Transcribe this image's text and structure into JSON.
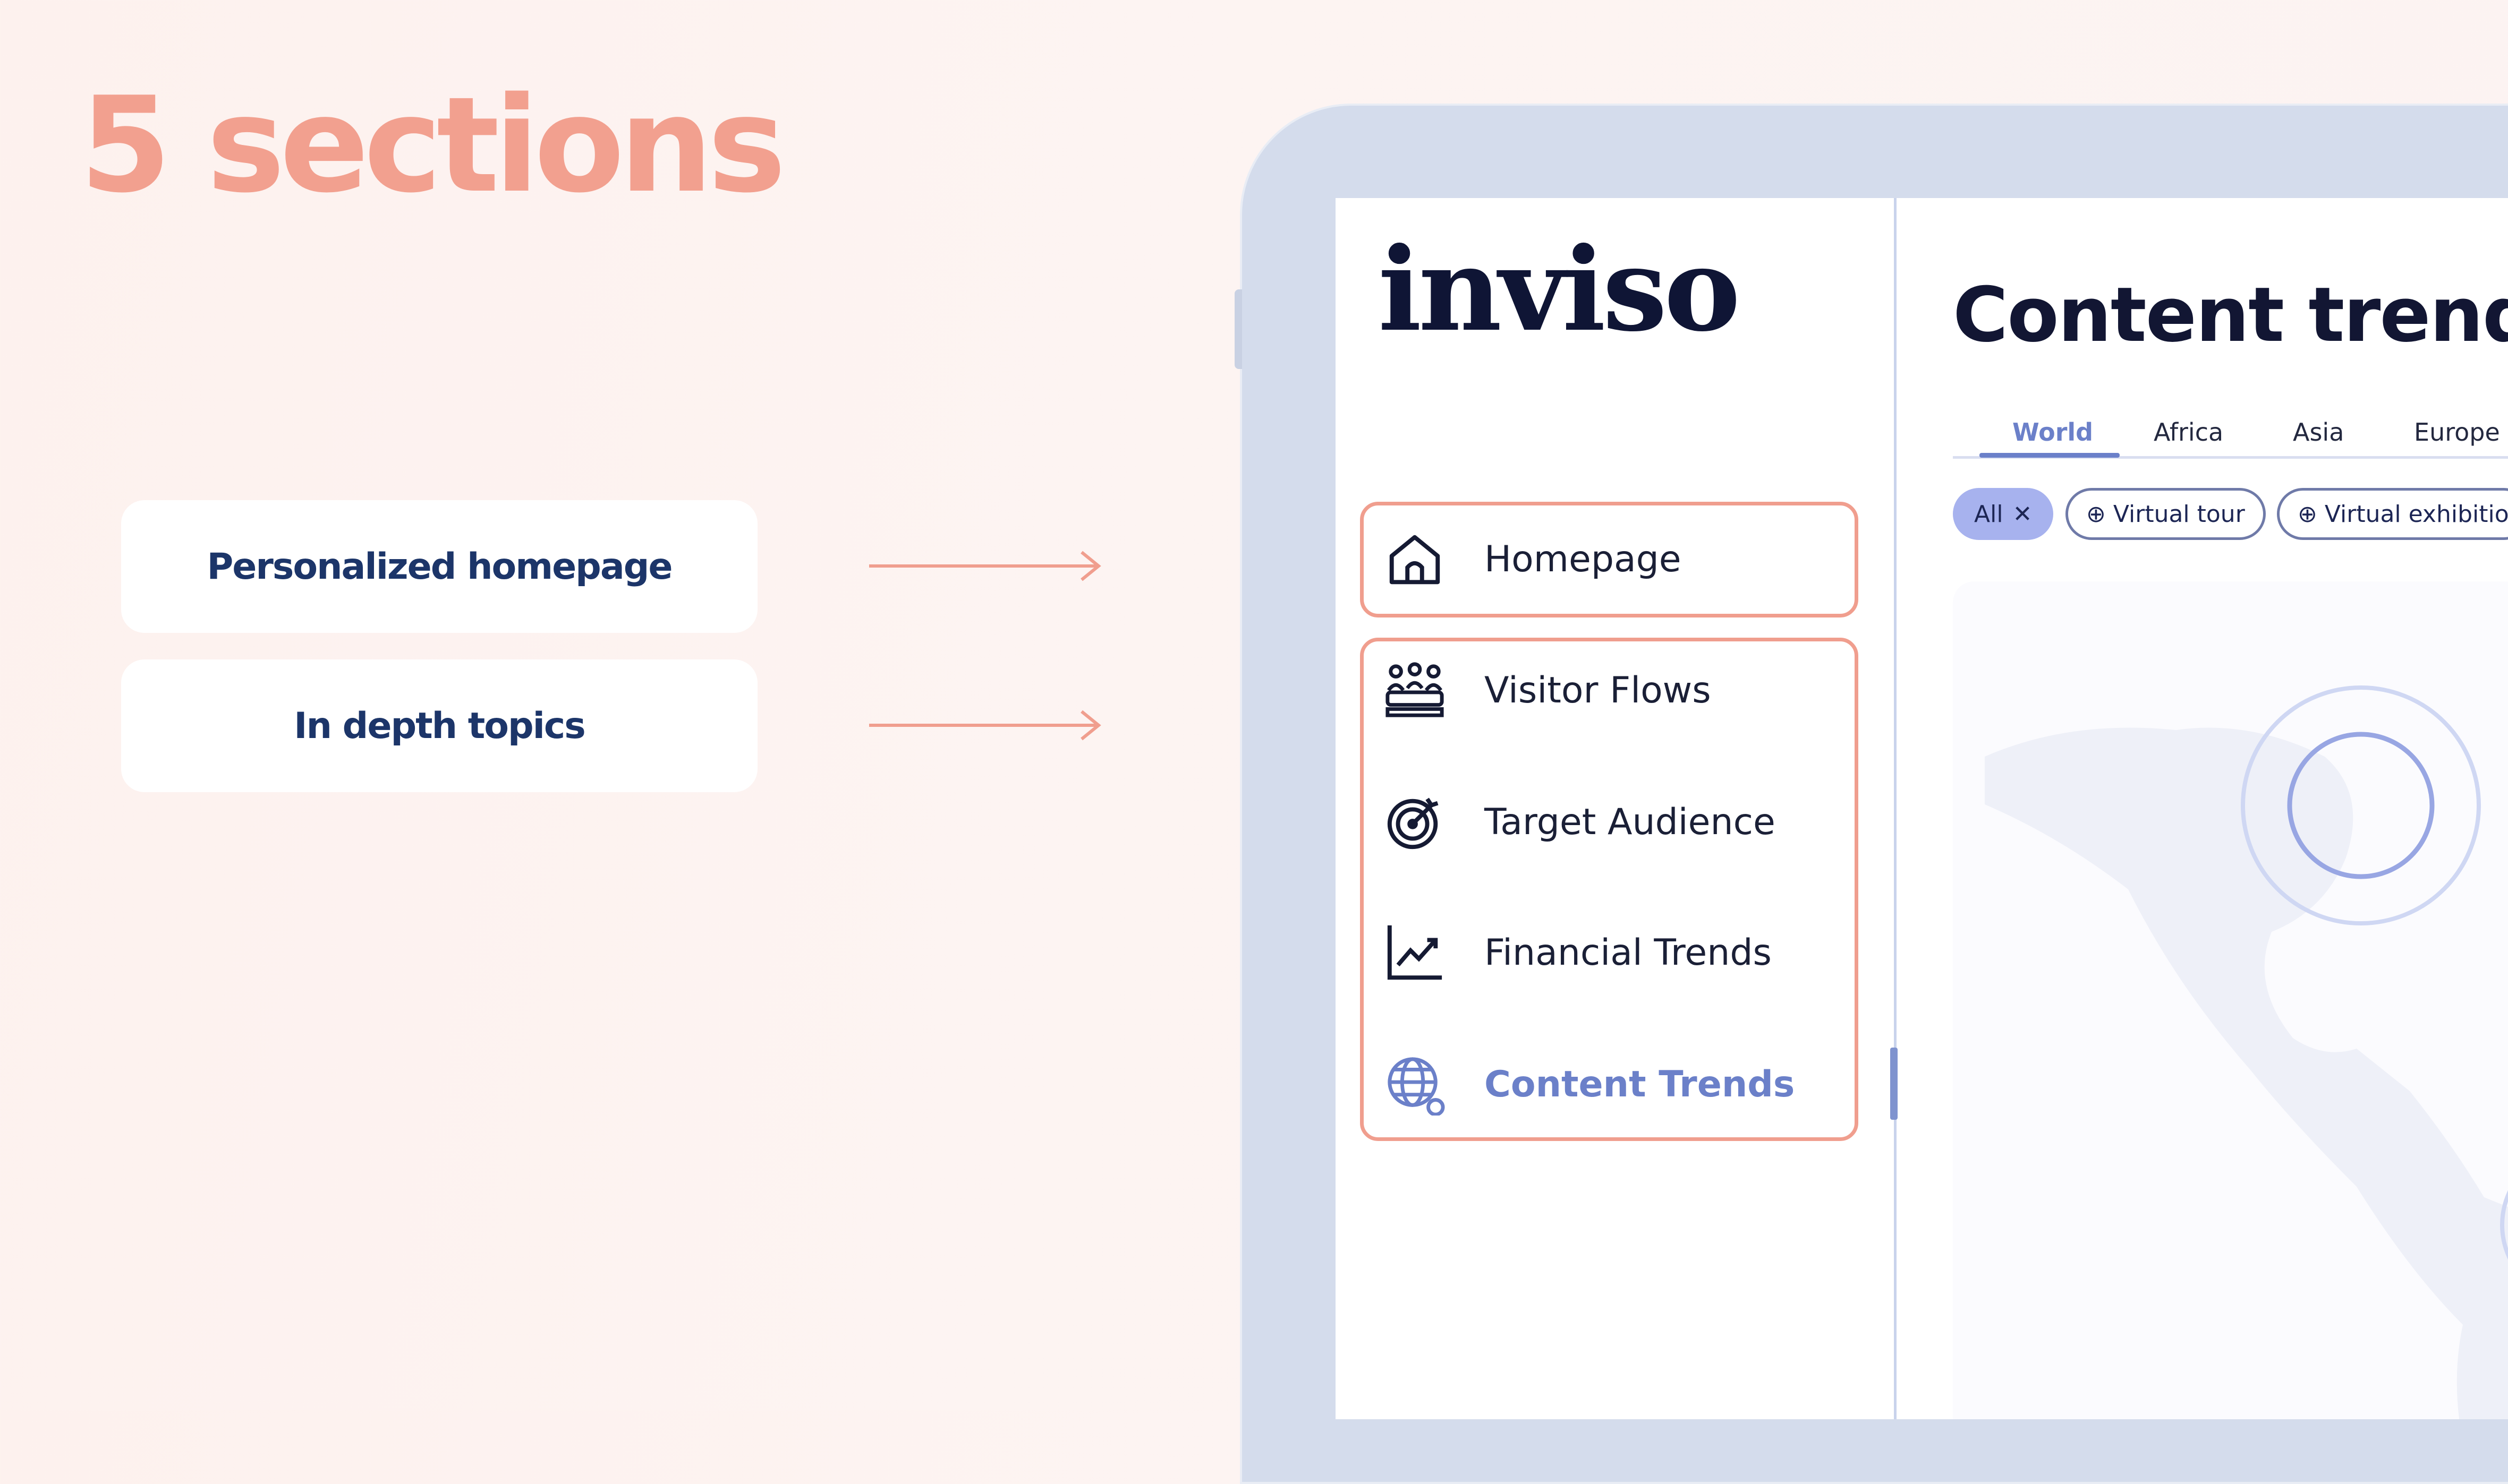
{
  "slide": {
    "title": "5 sections",
    "labels": [
      "Personalized homepage",
      "In depth topics"
    ]
  },
  "app": {
    "logo": "inviso",
    "nav": {
      "homepage": "Homepage",
      "visitor_flows": "Visitor Flows",
      "target_audience": "Target Audience",
      "financial_trends": "Financial Trends",
      "content_trends": "Content Trends"
    },
    "main": {
      "title": "Content trends",
      "tabs": [
        "World",
        "Africa",
        "Asia",
        "Europe"
      ],
      "active_tab": "World",
      "chips": {
        "all": "All",
        "virtual_tour": "Virtual tour",
        "virtual_exhibition": "Virtual exhibitio"
      }
    }
  },
  "colors": {
    "accent_coral": "#f2a08f",
    "navy": "#1c3569",
    "active_blue": "#6b80c9",
    "frame": "#d4dcec"
  },
  "icons": [
    "home-icon",
    "visitor-group-icon",
    "target-icon",
    "chart-trend-icon",
    "globe-icon",
    "arrow-right-icon",
    "plus-circle-icon",
    "close-icon"
  ]
}
